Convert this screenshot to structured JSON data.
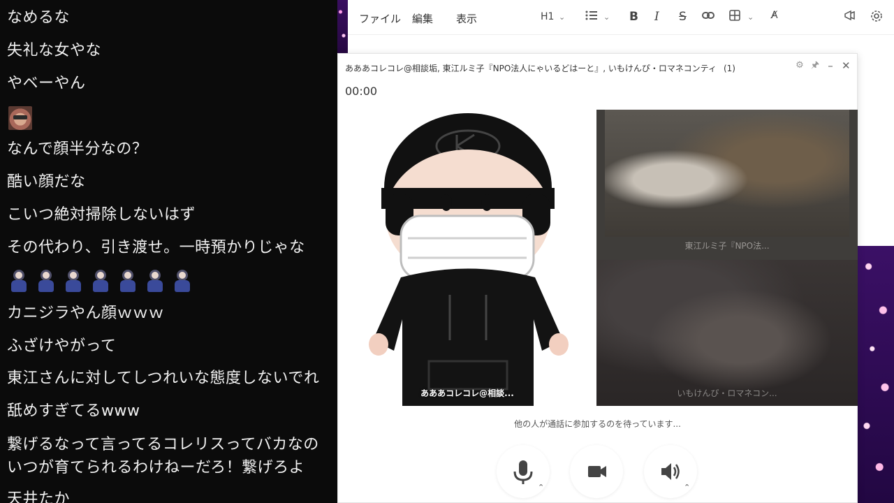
{
  "chat": {
    "comments": [
      "なめるな",
      "失礼な女やな",
      "やベーやん",
      "なんで顔半分なの？",
      "酷い顔だな",
      "こいつ絶対掃除しないはず",
      "その代わり、引き渡せ。一時預かりじゃな",
      "カニジラやん顔ｗｗｗ",
      "ふざけやがって",
      "東江さんに対してしつれいな態度しないでれ",
      "舐めすぎてるwww",
      "繋げるなって言ってるコレリスってバカなの",
      "いつが育てられるわけねーだろ！繋げろよ",
      "天井たか"
    ],
    "emoji_avatar_icon": "face-photo-icon",
    "figure_icon": "character-figure-icon",
    "figure_count": 7
  },
  "editor": {
    "menu": [
      "ファイル",
      "編集",
      "表示"
    ],
    "toolbar": {
      "heading": "H1",
      "list_icon": "list-icon",
      "bold": "B",
      "italic": "I",
      "strike": "S",
      "link_icon": "link-icon",
      "table_icon": "table-icon",
      "spell_icon": "spellcheck-icon",
      "megaphone_icon": "megaphone-icon",
      "settings_icon": "gear-icon"
    }
  },
  "call": {
    "title": "あああコレコレ@相談垢, 東江ルミ子『NPO法人にゃいるどはーと』, いもけんぴ・ロマネコンティ",
    "count": "(1)",
    "timer": "00:00",
    "main_name": "あああコレコレ@相談...",
    "right_name_1": "東江ルミ子『NPO法...",
    "right_name_2": "いもけんぴ・ロマネコン...",
    "waiting": "他の人が通話に参加するのを待っています...",
    "controls": [
      "microphone-icon",
      "camera-icon",
      "speaker-icon"
    ]
  },
  "colors": {
    "chat_bg": "#0b0b0b",
    "chat_text": "#f2f2f2",
    "window_bg": "#ffffff",
    "accent_purple": "#3b1066"
  }
}
